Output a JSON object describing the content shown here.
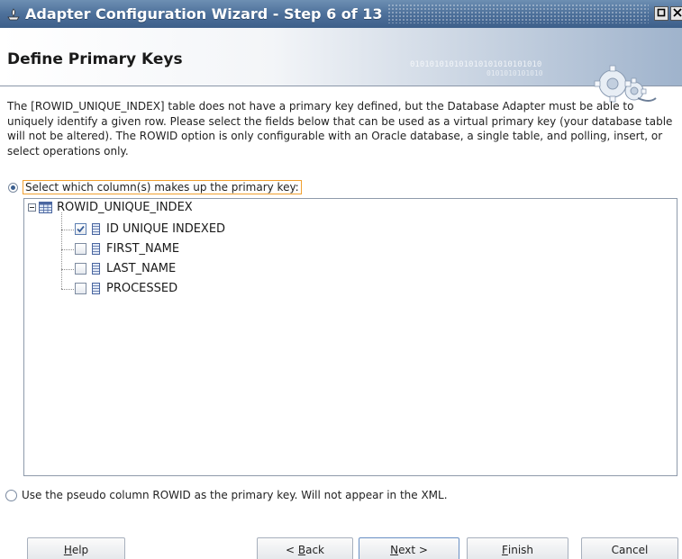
{
  "window": {
    "title": "Adapter Configuration Wizard - Step 6 of 13",
    "controls": [
      "restore",
      "close"
    ]
  },
  "header": {
    "title": "Define Primary Keys",
    "decoration_binary_1": "010101010101010101010101010",
    "decoration_binary_2": "0101010101010"
  },
  "description": "The [ROWID_UNIQUE_INDEX] table does not have a primary key defined, but the Database Adapter must be able to uniquely identify a given row.  Please select the fields below that can be used as a virtual primary key (your database table will not be altered).  The ROWID option is only configurable with an Oracle database, a single table, and polling, insert, or select operations only.",
  "option_select_columns": {
    "label": "Select which column(s) makes up the primary key:",
    "selected": true
  },
  "tree": {
    "table_name": "ROWID_UNIQUE_INDEX",
    "expanded": true,
    "columns": [
      {
        "name": "ID UNIQUE INDEXED",
        "checked": true
      },
      {
        "name": "FIRST_NAME",
        "checked": false
      },
      {
        "name": "LAST_NAME",
        "checked": false
      },
      {
        "name": "PROCESSED",
        "checked": false
      }
    ]
  },
  "option_rowid": {
    "label": "Use the pseudo column ROWID as the primary key.  Will not appear in the XML.",
    "selected": false
  },
  "buttons": {
    "help": {
      "mnemonic": "H",
      "rest": "elp"
    },
    "back": {
      "prefix": "< ",
      "mnemonic": "B",
      "rest": "ack"
    },
    "next": {
      "mnemonic": "N",
      "rest": "ext >"
    },
    "finish": {
      "mnemonic": "F",
      "rest": "inish"
    },
    "cancel": {
      "label": "Cancel"
    }
  }
}
